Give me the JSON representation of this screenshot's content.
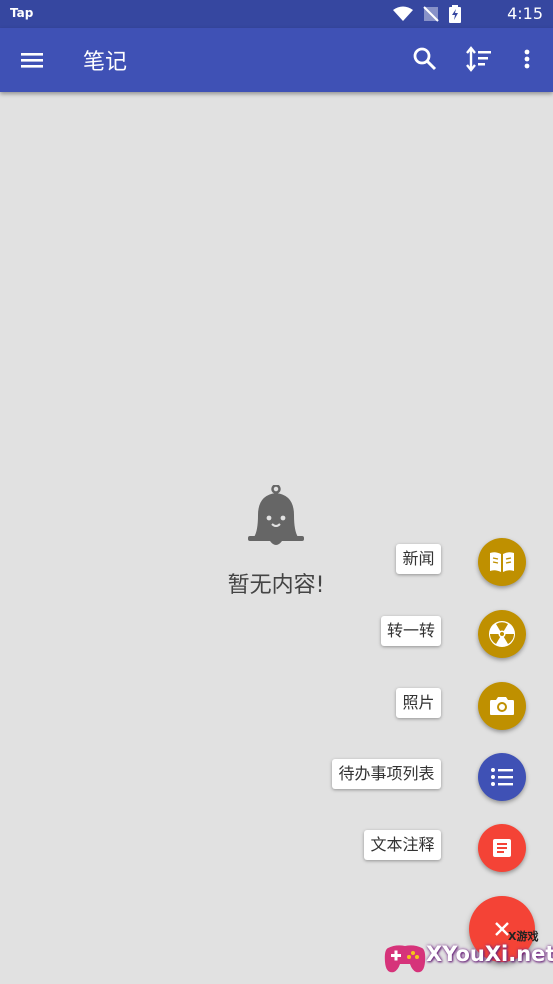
{
  "status_bar": {
    "app_name": "Tap",
    "time": "4:15"
  },
  "app_bar": {
    "title": "笔记",
    "icons": [
      "menu-icon",
      "search-icon",
      "sort-icon",
      "more-vert-icon"
    ]
  },
  "empty_state": {
    "icon": "bell-face-icon",
    "message": "暂无内容!"
  },
  "fab_menu": {
    "items": [
      {
        "label": "新闻",
        "icon": "book-icon",
        "color": "#bf9000"
      },
      {
        "label": "转一转",
        "icon": "radiation-icon",
        "color": "#bf9000"
      },
      {
        "label": "照片",
        "icon": "camera-icon",
        "color": "#bf9000"
      },
      {
        "label": "待办事项列表",
        "icon": "list-icon",
        "color": "#3f51b5"
      },
      {
        "label": "文本注释",
        "icon": "note-icon",
        "color": "#f44336"
      }
    ],
    "main": {
      "icon": "close-icon",
      "color": "#f44336"
    }
  },
  "watermark": {
    "text": "XYouXi.net",
    "small_text": "X游戏"
  },
  "colors": {
    "app_bar": "#3f51b5",
    "status_bar": "#3647a0",
    "background": "#e1e1e1"
  }
}
